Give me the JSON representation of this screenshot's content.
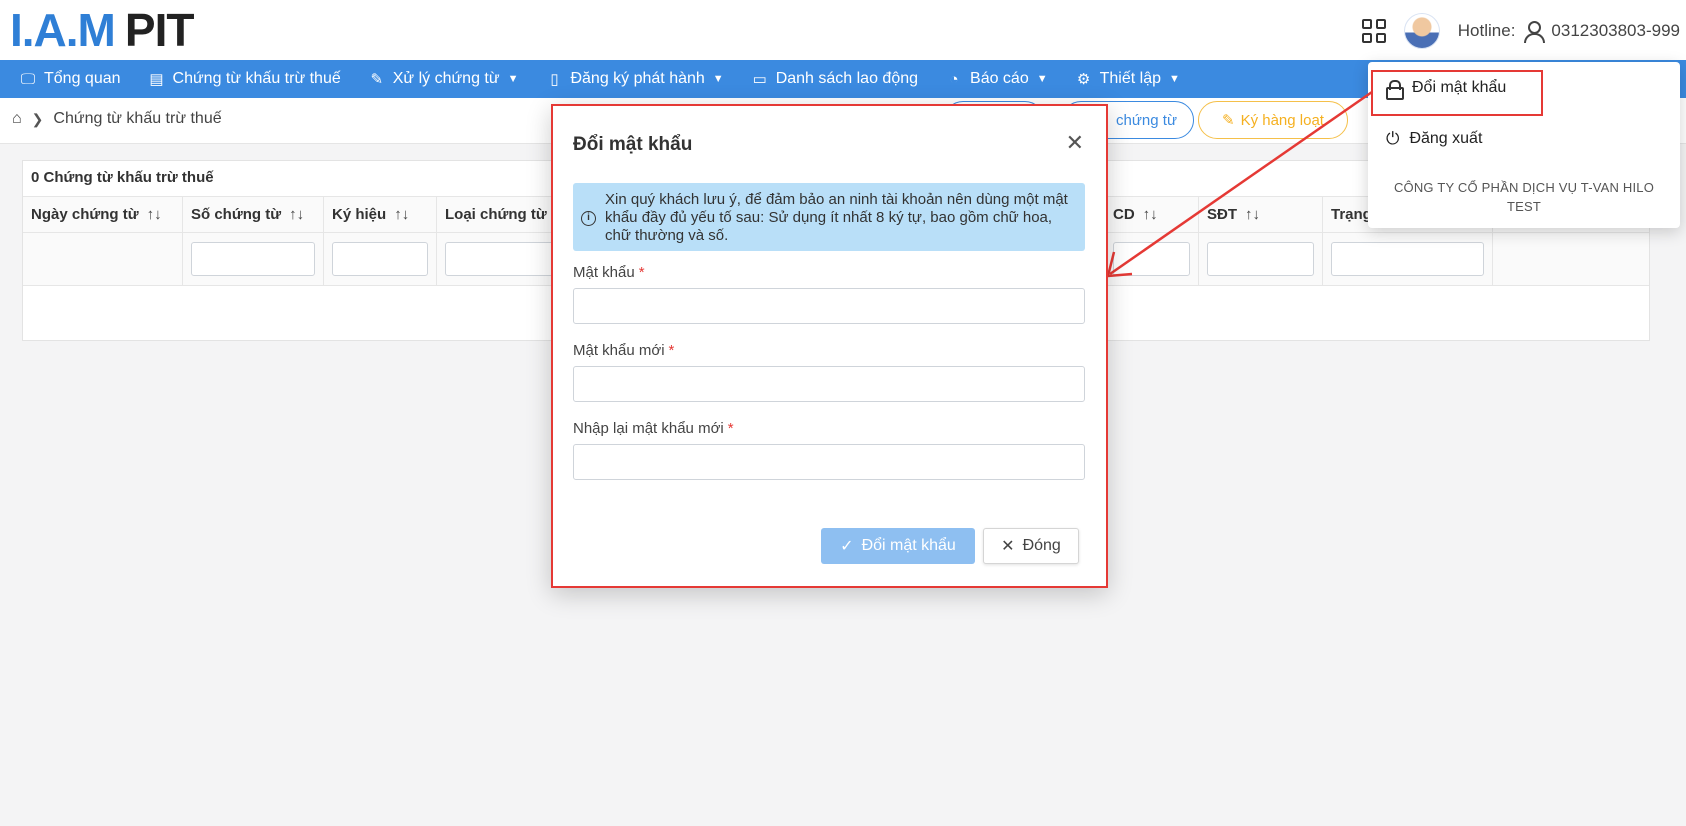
{
  "header": {
    "logo_iam": "I.A.M",
    "logo_pit": "PIT",
    "hotline_label": "Hotline:",
    "hotline_number": "0312303803-999"
  },
  "nav": {
    "items": [
      {
        "label": "Tổng quan",
        "icon": "monitor-icon"
      },
      {
        "label": "Chứng từ khấu trừ thuế",
        "icon": "calendar-icon"
      },
      {
        "label": "Xử lý chứng từ",
        "icon": "pen-icon"
      },
      {
        "label": "Đăng ký phát hành",
        "icon": "file-icon"
      },
      {
        "label": "Danh sách lao động",
        "icon": "id-card-icon"
      },
      {
        "label": "Báo cáo",
        "icon": "chart-icon"
      },
      {
        "label": "Thiết lập",
        "icon": "gear-icon"
      }
    ]
  },
  "breadcrumb": {
    "current": "Chứng từ khấu trừ thuế"
  },
  "toolbar": {
    "btn_chungtu": "chứng từ",
    "btn_kyhangloat": "Ký hàng loạt"
  },
  "table": {
    "title": "0 Chứng từ khấu trừ thuế",
    "columns": [
      "Ngày chứng từ",
      "Số chứng từ",
      "Ký hiệu",
      "Loại chứng từ",
      "CD",
      "SĐT",
      "Trạng"
    ]
  },
  "user_menu": {
    "change_password": "Đổi mật khẩu",
    "logout": "Đăng xuất",
    "company": "CÔNG TY CỔ PHẦN DỊCH VỤ T-VAN HILO TEST"
  },
  "modal": {
    "title": "Đổi mật khẩu",
    "notice": "Xin quý khách lưu ý, để đảm bảo an ninh tài khoản nên dùng một mật khẩu đầy đủ yếu tố sau: Sử dụng ít nhất 8 ký tự, bao gồm chữ hoa, chữ thường và số.",
    "field_password": "Mật khẩu",
    "field_new_password": "Mật khẩu mới",
    "field_confirm_password": "Nhập lại mật khẩu mới",
    "submit_label": "Đổi mật khẩu",
    "close_label": "Đóng"
  },
  "colors": {
    "nav_bg": "#3b8ae0",
    "highlight": "#e53935",
    "notice_bg": "#b9dff8",
    "primary_disabled": "#8ebff1"
  }
}
